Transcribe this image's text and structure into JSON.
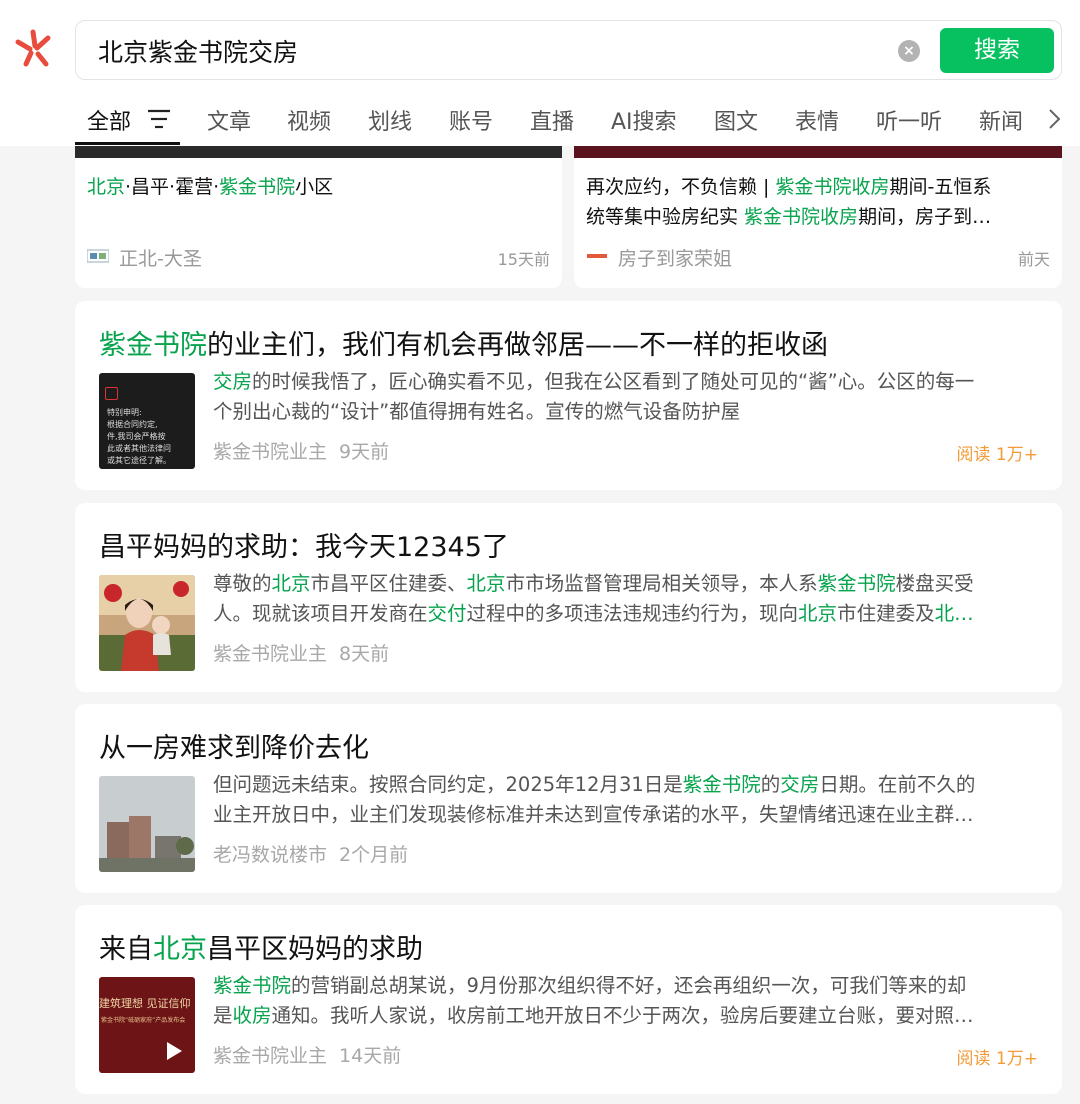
{
  "search": {
    "query": "北京紫金书院交房",
    "button_label": "搜索",
    "clear_icon": "clear-icon"
  },
  "tabs": [
    {
      "label": "全部",
      "active": true
    },
    {
      "label": "文章"
    },
    {
      "label": "视频"
    },
    {
      "label": "划线"
    },
    {
      "label": "账号"
    },
    {
      "label": "直播"
    },
    {
      "label": "AI搜索"
    },
    {
      "label": "图文"
    },
    {
      "label": "表情"
    },
    {
      "label": "听一听"
    },
    {
      "label": "新闻"
    }
  ],
  "mini_cards": [
    {
      "segments": [
        {
          "t": "北京",
          "hl": true
        },
        {
          "t": "·昌平·霍营·"
        },
        {
          "t": "紫金书院",
          "hl": true
        },
        {
          "t": "小区"
        }
      ],
      "source": "正北-大圣",
      "time": "15天前"
    },
    {
      "line1": [
        {
          "t": "再次应约，不负信赖 | "
        },
        {
          "t": "紫金书院收房",
          "hl": true
        },
        {
          "t": "期间-五恒系"
        }
      ],
      "line2": [
        {
          "t": "统等集中验房纪实 "
        },
        {
          "t": "紫金书院收房",
          "hl": true
        },
        {
          "t": "期间，房子到…"
        }
      ],
      "source": "房子到家荣姐",
      "time": "前天"
    }
  ],
  "results": [
    {
      "title": [
        {
          "t": "紫金书院",
          "hl": true
        },
        {
          "t": "的业主们，我们有机会再做邻居——不一样的拒收函"
        }
      ],
      "line1": [
        {
          "t": "交房",
          "hl": true
        },
        {
          "t": "的时候我悟了，匠心确实看不见，但我在公区看到了随处可见的“酱”心。公区的每一"
        }
      ],
      "line2": [
        {
          "t": "个别出心裁的“设计”都值得拥有姓名。宣传的燃气设备防护屋"
        }
      ],
      "source": "紫金书院业主",
      "time": "9天前",
      "reads": "阅读 1万+",
      "thumb_text": [
        "特别申明:",
        "根据合同约定,",
        "件,我司会严格按",
        "此或者其他法律问",
        "或其它途径了解。"
      ]
    },
    {
      "title": [
        {
          "t": "昌平妈妈的求助：我今天12345了"
        }
      ],
      "line1": [
        {
          "t": "尊敬的"
        },
        {
          "t": "北京",
          "hl": true
        },
        {
          "t": "市昌平区住建委、"
        },
        {
          "t": "北京",
          "hl": true
        },
        {
          "t": "市市场监督管理局相关领导，本人系"
        },
        {
          "t": "紫金书院",
          "hl": true
        },
        {
          "t": "楼盘买受"
        }
      ],
      "line2": [
        {
          "t": "人。现就该项目开发商在"
        },
        {
          "t": "交付",
          "hl": true
        },
        {
          "t": "过程中的多项违法违规违约行为，现向"
        },
        {
          "t": "北京",
          "hl": true
        },
        {
          "t": "市住建委及"
        },
        {
          "t": "北…",
          "hl": true
        }
      ],
      "source": "紫金书院业主",
      "time": "8天前",
      "reads": ""
    },
    {
      "title": [
        {
          "t": "从一房难求到降价去化"
        }
      ],
      "line1": [
        {
          "t": "但问题远未结束。按照合同约定，2025年12月31日是"
        },
        {
          "t": "紫金书院",
          "hl": true
        },
        {
          "t": "的"
        },
        {
          "t": "交房",
          "hl": true
        },
        {
          "t": "日期。在前不久的"
        }
      ],
      "line2": [
        {
          "t": "业主开放日中，业主们发现装修标准并未达到宣传承诺的水平，失望情绪迅速在业主群…"
        }
      ],
      "source": "老冯数说楼市",
      "time": "2个月前",
      "reads": ""
    },
    {
      "title": [
        {
          "t": "来自"
        },
        {
          "t": "北京",
          "hl": true
        },
        {
          "t": "昌平区妈妈的求助"
        }
      ],
      "line1": [
        {
          "t": "紫金书院",
          "hl": true
        },
        {
          "t": "的营销副总胡某说，9月份那次组织得不好，还会再组织一次，可我们等来的却"
        }
      ],
      "line2": [
        {
          "t": "是"
        },
        {
          "t": "收房",
          "hl": true
        },
        {
          "t": "通知。我听人家说，收房前工地开放日不少于两次，验房后要建立台账，要对照…"
        }
      ],
      "source": "紫金书院业主",
      "time": "14天前",
      "reads": "阅读 1万+",
      "thumb_text": [
        "建筑理想 见证信仰",
        "紫金书院“砥砺家府”产品发布会"
      ]
    }
  ]
}
